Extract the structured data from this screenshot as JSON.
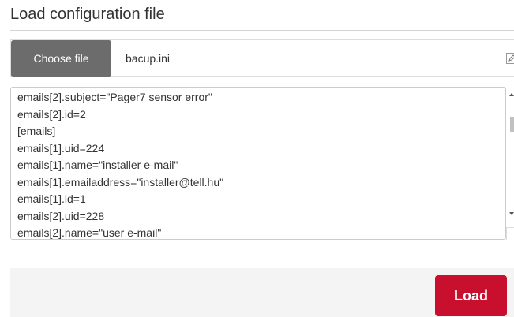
{
  "dialog": {
    "title": "Load configuration file"
  },
  "file_input": {
    "button_label": "Choose file",
    "file_name": "bacup.ini",
    "icon": "edit-icon"
  },
  "content": {
    "lines": [
      "emails[2].subject=\"Pager7 sensor error\"",
      "emails[2].id=2",
      "[emails]",
      "emails[1].uid=224",
      "emails[1].name=\"installer e-mail\"",
      "emails[1].emailaddress=\"installer@tell.hu\"",
      "emails[1].id=1",
      "emails[2].uid=228",
      "emails[2].name=\"user e-mail\""
    ]
  },
  "footer": {
    "load_label": "Load"
  },
  "colors": {
    "choose_button": "#6c6c6c",
    "load_button": "#c8102e",
    "footer_background": "#f4f4f4"
  }
}
